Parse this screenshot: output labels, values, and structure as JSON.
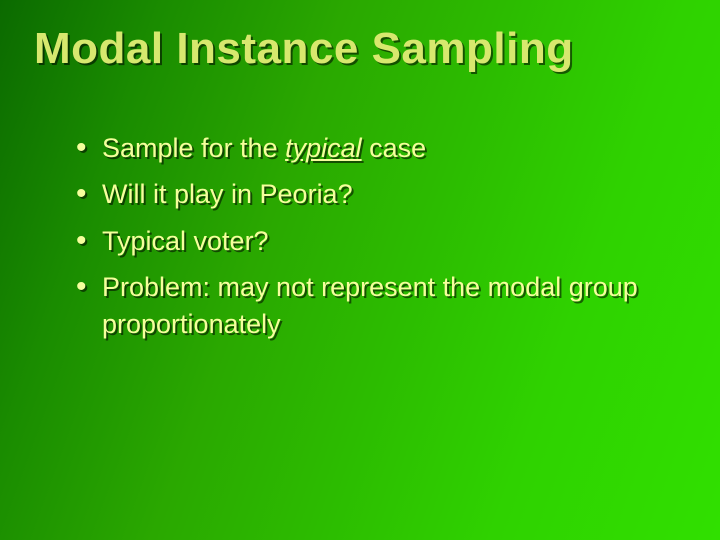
{
  "title": "Modal Instance Sampling",
  "bullets": {
    "b0_pre": "Sample for the ",
    "b0_em": "typical",
    "b0_post": " case",
    "b1": "Will it play in Peoria?",
    "b2": "Typical voter?",
    "b3": "Problem: may not represent the modal group proportionately"
  }
}
